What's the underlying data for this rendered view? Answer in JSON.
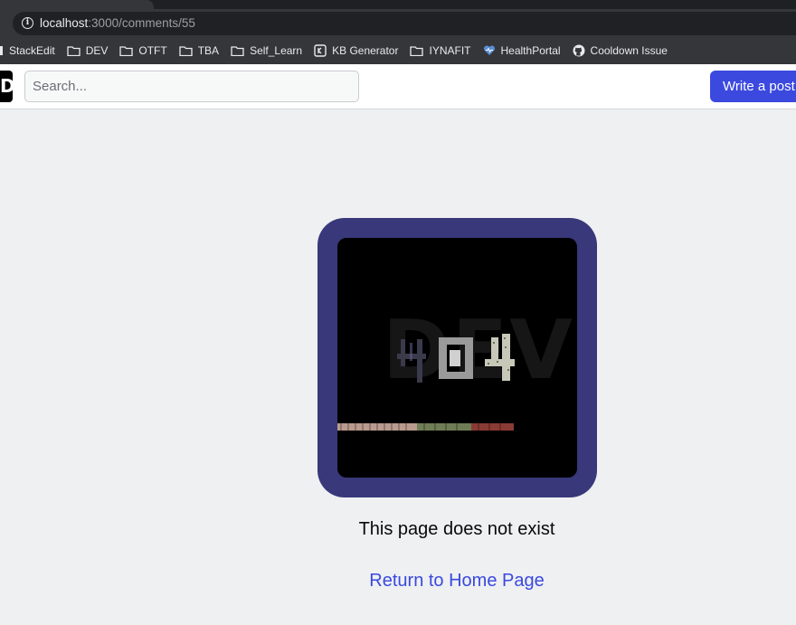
{
  "browser": {
    "url_host": "localhost",
    "url_path": ":3000/comments/55",
    "bookmarks": [
      {
        "label": "StackEdit",
        "icon": "stackedit-icon"
      },
      {
        "label": "DEV",
        "icon": "folder-icon"
      },
      {
        "label": "OTFT",
        "icon": "folder-icon"
      },
      {
        "label": "TBA",
        "icon": "folder-icon"
      },
      {
        "label": "Self_Learn",
        "icon": "folder-icon"
      },
      {
        "label": "KB Generator",
        "icon": "kb-generator-icon"
      },
      {
        "label": "IYNAFIT",
        "icon": "folder-icon"
      },
      {
        "label": "HealthPortal",
        "icon": "heart-icon"
      },
      {
        "label": "Cooldown Issue",
        "icon": "github-icon"
      }
    ]
  },
  "header": {
    "logo": "DEV",
    "search_placeholder": "Search...",
    "write_button": "Write a post"
  },
  "error_page": {
    "image_text": "404",
    "image_brand": "DEV",
    "message": "This page does not exist",
    "home_link": "Return to Home Page"
  },
  "colors": {
    "accent": "#3b49df",
    "frame": "#38387a",
    "page_bg": "#eef0f1"
  }
}
